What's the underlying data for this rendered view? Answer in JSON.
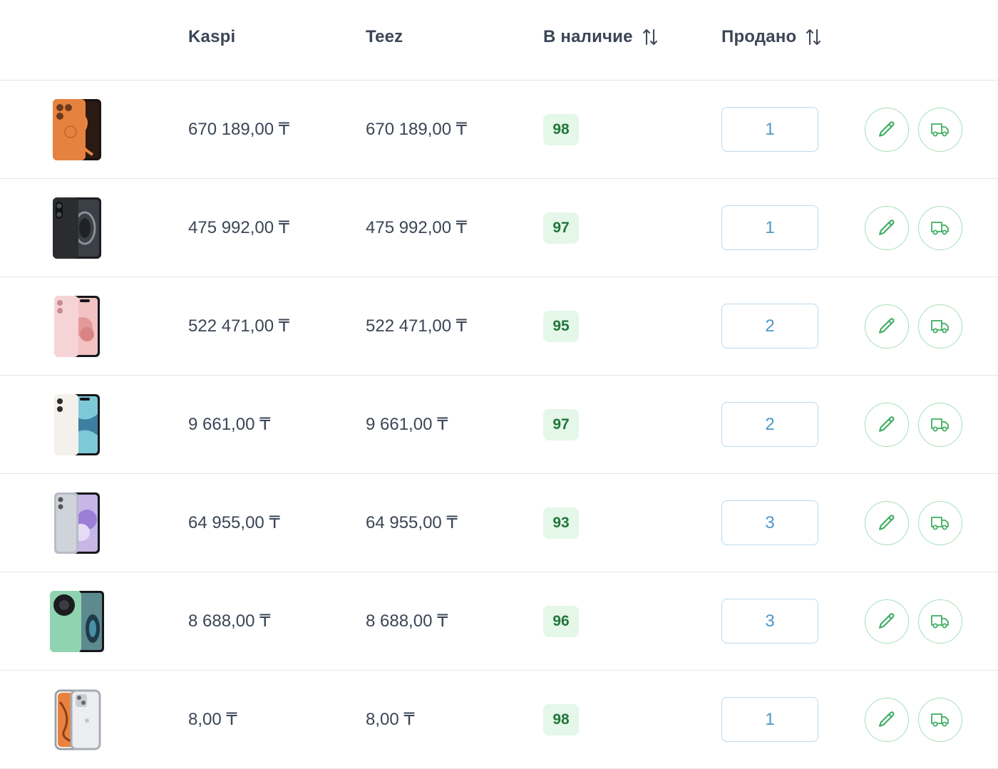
{
  "header": {
    "kaspi": "Kaspi",
    "teez": "Teez",
    "stock": "В наличие",
    "sold": "Продано"
  },
  "colors": {
    "text": "#3b4656",
    "badge_bg": "#e4f7e8",
    "badge_text": "#23763c",
    "input_border": "#bcd9ec",
    "input_text": "#4c97c9",
    "action_border": "#a6dfb7",
    "action_icon": "#3fae62"
  },
  "rows": [
    {
      "image": "phone-orange-pro",
      "kaspi": "670 189,00 ₸",
      "teez": "670 189,00 ₸",
      "stock": "98",
      "sold": "1"
    },
    {
      "image": "phone-black",
      "kaspi": "475 992,00 ₸",
      "teez": "475 992,00 ₸",
      "stock": "97",
      "sold": "1"
    },
    {
      "image": "phone-pink",
      "kaspi": "522 471,00 ₸",
      "teez": "522 471,00 ₸",
      "stock": "95",
      "sold": "2"
    },
    {
      "image": "phone-starlight",
      "kaspi": "9 661,00 ₸",
      "teez": "9 661,00 ₸",
      "stock": "97",
      "sold": "2"
    },
    {
      "image": "phone-silver-purple",
      "kaspi": "64 955,00 ₸",
      "teez": "64 955,00 ₸",
      "stock": "93",
      "sold": "3"
    },
    {
      "image": "phone-green-round-camera",
      "kaspi": "8 688,00 ₸",
      "teez": "8 688,00 ₸",
      "stock": "96",
      "sold": "3"
    },
    {
      "image": "phone-clear-case",
      "kaspi": "8,00 ₸",
      "teez": "8,00 ₸",
      "stock": "98",
      "sold": "1"
    }
  ]
}
